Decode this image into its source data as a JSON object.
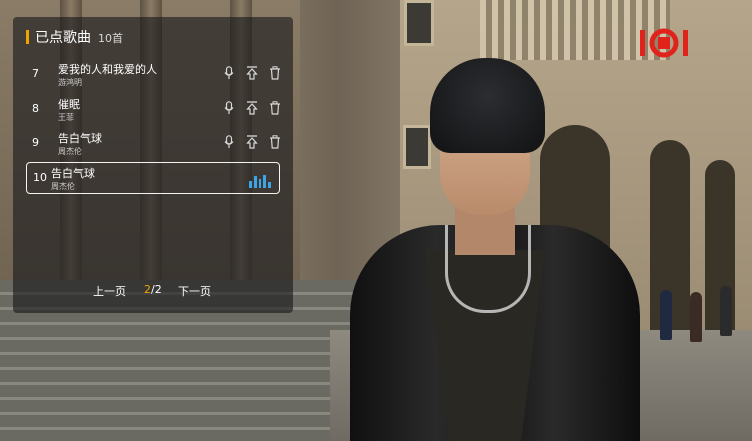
{
  "playlist": {
    "title": "已点歌曲",
    "count": "10首",
    "songs": [
      {
        "number": "7",
        "title": "爱我的人和我爱的人",
        "artist": "游鸿明"
      },
      {
        "number": "8",
        "title": "催眠",
        "artist": "王菲"
      },
      {
        "number": "9",
        "title": "告白气球",
        "artist": "周杰伦"
      },
      {
        "number": "10",
        "title": "告白气球",
        "artist": "周杰伦"
      }
    ],
    "active_index": 3,
    "row_icons": [
      "microphone-icon",
      "move-to-top-icon",
      "delete-icon"
    ]
  },
  "pager": {
    "prev_label": "上一页",
    "current_page": "2",
    "total_pages": "/2",
    "next_label": "下一页"
  },
  "brand": {
    "logo_text": "IOBI"
  },
  "colors": {
    "accent": "#f0a400",
    "equalizer": "#3aa6e8",
    "logo_red": "#e0241b",
    "panel_bg": "rgba(25,25,28,0.62)"
  }
}
